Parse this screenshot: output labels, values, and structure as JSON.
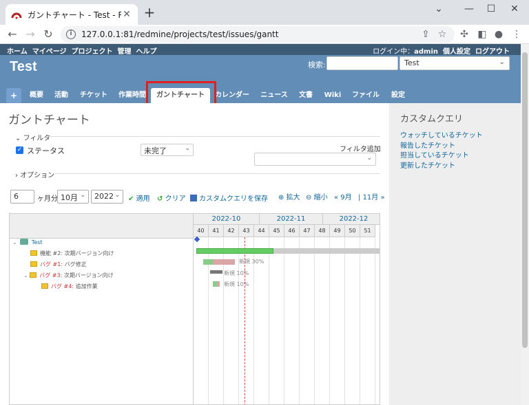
{
  "browser": {
    "tab_title": "ガントチャート - Test - Redmine",
    "url": "127.0.0.1:81/redmine/projects/test/issues/gantt"
  },
  "topmenu": {
    "left": [
      "ホーム",
      "マイページ",
      "プロジェクト",
      "管理",
      "ヘルプ"
    ],
    "logged_in_label": "ログイン中：",
    "user": "admin",
    "my_account": "個人設定",
    "logout": "ログアウト"
  },
  "header": {
    "project_title": "Test",
    "search_label": "検索:",
    "project_jump": "Test"
  },
  "mainmenu": {
    "new_label": "+",
    "tabs": [
      "概要",
      "活動",
      "チケット",
      "作業時間",
      "ガントチャート",
      "カレンダー",
      "ニュース",
      "文書",
      "Wiki",
      "ファイル",
      "設定"
    ]
  },
  "content": {
    "title": "ガントチャート",
    "filter_legend": "フィルタ",
    "status_label": "ステータス",
    "status_value": "未完了",
    "add_filter_label": "フィルタ追加",
    "option_legend": "オプション",
    "months_value": "6",
    "months_label": "ヶ月分",
    "month_value": "10月",
    "year_value": "2022",
    "apply": "適用",
    "clear": "クリア",
    "save_query": "カスタムクエリを保存",
    "zoom_in": "拡大",
    "zoom_out": "縮小",
    "prev": "« 9月",
    "sep": "|",
    "next": "11月 »"
  },
  "gantt": {
    "months": [
      "2022-10",
      "2022-11",
      "2022-12"
    ],
    "weeks": [
      "40",
      "41",
      "42",
      "43",
      "44",
      "45",
      "46",
      "47",
      "48",
      "49",
      "50",
      "51"
    ],
    "rows": [
      {
        "kind": "project",
        "text": "Test"
      },
      {
        "kind": "version",
        "text": "機能 #2: 次期バージョン向け"
      },
      {
        "kind": "issue",
        "tracker": "バグ #1:",
        "text": "バグ修正"
      },
      {
        "kind": "issue",
        "tracker": "バグ #3:",
        "text": "次期バージョン向け"
      },
      {
        "kind": "issue",
        "tracker": "バグ #4:",
        "text": "追加作業"
      }
    ],
    "labels": [
      "新規 30%",
      "新規 10%",
      "新規 10%"
    ]
  },
  "sidebar": {
    "title": "カスタムクエリ",
    "links": [
      "ウォッチしているチケット",
      "報告したチケット",
      "担当しているチケット",
      "更新したチケット"
    ]
  }
}
